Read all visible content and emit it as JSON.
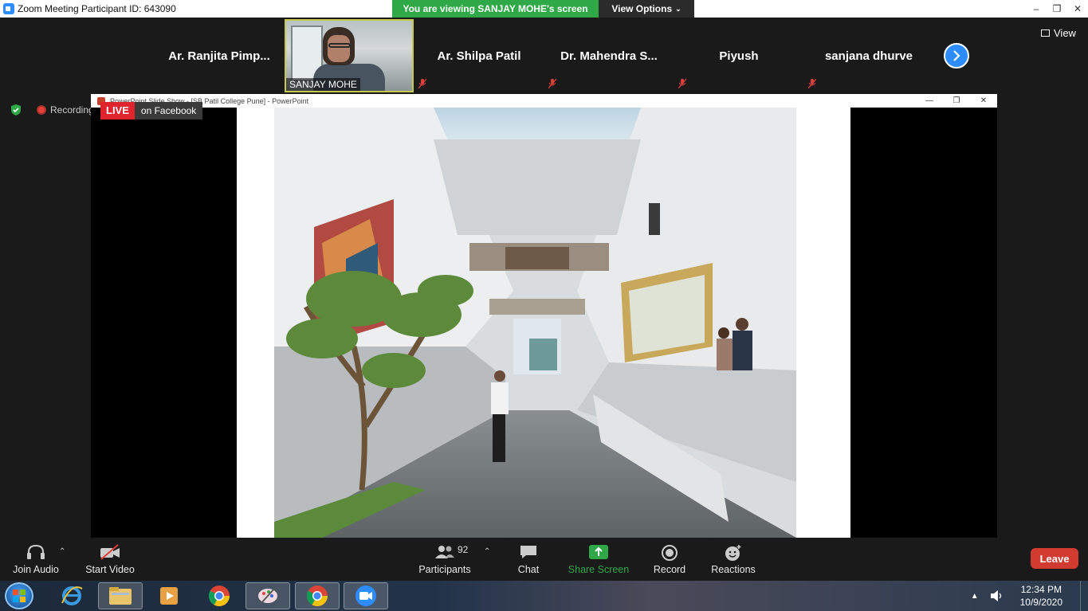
{
  "titlebar": {
    "title": "Zoom Meeting Participant ID: 643090",
    "viewing_banner": "You are viewing SANJAY MOHE's screen",
    "view_options": "View Options",
    "minimize": "–",
    "restore": "❐",
    "close": "✕"
  },
  "gallery": {
    "participants": [
      {
        "name": "Ar. Ranjita Pimp...",
        "muted": false
      },
      {
        "name": "Ar. Shilpa Patil",
        "muted": true
      },
      {
        "name": "Dr. Mahendra S...",
        "muted": true
      },
      {
        "name": "Piyush",
        "muted": true
      },
      {
        "name": "sanjana dhurve",
        "muted": true
      }
    ],
    "active_speaker": "SANJAY MOHE",
    "view_label": "View"
  },
  "indicators": {
    "recording": "Recording",
    "live": "LIVE",
    "live_platform": "on Facebook"
  },
  "shared_window": {
    "title": "PowerPoint Slide Show - [SB Patil College Pune] - PowerPoint"
  },
  "toolbar": {
    "join_audio": "Join Audio",
    "start_video": "Start Video",
    "participants_count": "92",
    "participants": "Participants",
    "chat": "Chat",
    "share_screen": "Share Screen",
    "record": "Record",
    "reactions": "Reactions",
    "leave": "Leave",
    "share_color": "#2fa848",
    "leave_color": "#d13b30"
  },
  "taskbar": {
    "time": "12:34 PM",
    "date": "10/9/2020",
    "apps": [
      "windows-start",
      "internet-explorer",
      "file-explorer",
      "media-player",
      "chrome",
      "paint",
      "chrome",
      "zoom"
    ]
  }
}
